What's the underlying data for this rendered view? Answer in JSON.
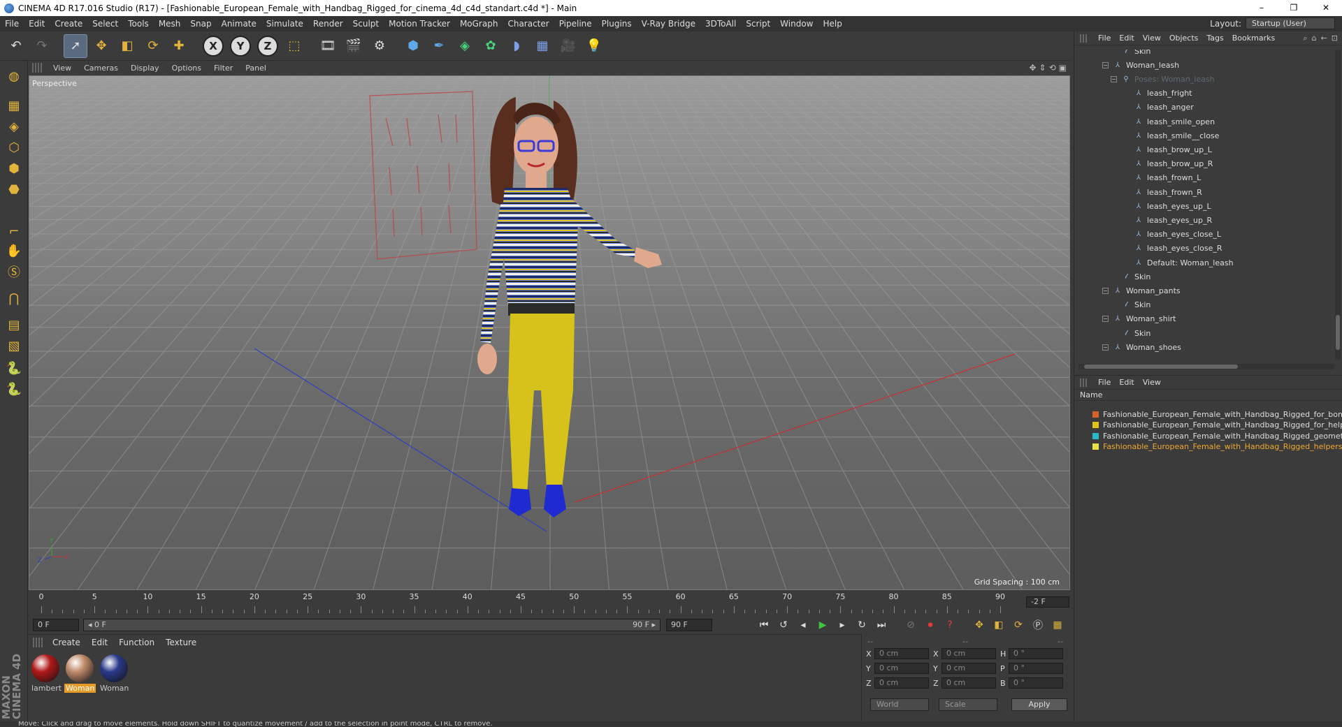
{
  "window": {
    "title": "CINEMA 4D R17.016 Studio (R17) - [Fashionable_European_Female_with_Handbag_Rigged_for_cinema_4d_c4d_standart.c4d *] - Main",
    "controls": [
      "–",
      "❐",
      "✕"
    ]
  },
  "menubar": {
    "items": [
      "File",
      "Edit",
      "Create",
      "Select",
      "Tools",
      "Mesh",
      "Snap",
      "Animate",
      "Simulate",
      "Render",
      "Sculpt",
      "Motion Tracker",
      "MoGraph",
      "Character",
      "Pipeline",
      "Plugins",
      "V-Ray Bridge",
      "3DToAll",
      "Script",
      "Window",
      "Help"
    ],
    "layout_label": "Layout:",
    "layout_value": "Startup (User)"
  },
  "toolbar": {
    "icons": [
      "undo-icon",
      "redo-icon",
      "live-select-icon",
      "move-icon",
      "scale-icon",
      "rotate-icon",
      "add-object-icon",
      "x-axis-icon",
      "y-axis-icon",
      "z-axis-icon",
      "coordinate-system-icon",
      "render-view-icon",
      "render-picture-viewer-icon",
      "render-settings-icon",
      "cube-icon",
      "pen-spline-icon",
      "subdivision-icon",
      "cloner-icon",
      "deformer-icon",
      "floor-icon",
      "camera-icon",
      "light-icon"
    ],
    "axis_labels": [
      "X",
      "Y",
      "Z"
    ]
  },
  "lefttools": [
    "model-mode-icon",
    "texture-mode-icon",
    "workplane-icon",
    "points-mode-icon",
    "edges-mode-icon",
    "polygons-mode-icon",
    "axis-mode-icon",
    "tweak-icon",
    "snap-icon",
    "magnet-icon",
    "grid-lock-icon",
    "grid-workplane-icon",
    "python-icon",
    "python-2-icon"
  ],
  "maxon_logo": "MAXON CINEMA 4D",
  "viewport": {
    "menu": [
      "View",
      "Cameras",
      "Display",
      "Options",
      "Filter",
      "Panel"
    ],
    "label": "Perspective",
    "grid_spacing": "Grid Spacing : 100 cm"
  },
  "timeline": {
    "ticks": [
      "0",
      "5",
      "10",
      "15",
      "20",
      "25",
      "30",
      "35",
      "40",
      "45",
      "50",
      "55",
      "60",
      "65",
      "70",
      "75",
      "80",
      "85",
      "90"
    ],
    "current_frame": "-2 F"
  },
  "transport": {
    "start_field": "0 F",
    "range_start": "◂ 0 F",
    "range_end": "90 F ▸",
    "end_field": "90 F"
  },
  "materials": {
    "menu": [
      "Create",
      "Edit",
      "Function",
      "Texture"
    ],
    "items": [
      {
        "name": "lambert",
        "color": "#b01818",
        "selected": false
      },
      {
        "name": "Woman",
        "color": "#c08a6a",
        "selected": true
      },
      {
        "name": "Woman",
        "color": "#2a3a8a",
        "selected": false
      }
    ]
  },
  "coordinates": {
    "headers": [
      "--",
      "--",
      "--"
    ],
    "rows": [
      {
        "a": "X",
        "a_val": "0 cm",
        "b": "X",
        "b_val": "0 cm",
        "c": "H",
        "c_val": "0 °"
      },
      {
        "a": "Y",
        "a_val": "0 cm",
        "b": "Y",
        "b_val": "0 cm",
        "c": "P",
        "c_val": "0 °"
      },
      {
        "a": "Z",
        "a_val": "0 cm",
        "b": "Z",
        "b_val": "0 cm",
        "c": "B",
        "c_val": "0 °"
      }
    ],
    "mode": "World",
    "scale_mode": "Scale",
    "apply": "Apply"
  },
  "object_manager": {
    "menu": [
      "File",
      "Edit",
      "View",
      "Objects",
      "Tags",
      "Bookmarks"
    ],
    "tree": [
      {
        "label": "Skin",
        "icon": "skin-icon",
        "indent": 1,
        "dim": false
      },
      {
        "label": "Woman_leash",
        "icon": "joint-icon",
        "indent": 0,
        "dim": false,
        "expander": "−"
      },
      {
        "label": "Poses: Woman_leash",
        "icon": "pose-morph-icon",
        "indent": 1,
        "dim": true,
        "expander": "−"
      },
      {
        "label": "leash_fright",
        "icon": "pose-icon",
        "indent": 2,
        "dim": false
      },
      {
        "label": "leash_anger",
        "icon": "pose-icon",
        "indent": 2,
        "dim": false
      },
      {
        "label": "leash_smile_open",
        "icon": "pose-icon",
        "indent": 2,
        "dim": false
      },
      {
        "label": "leash_smile__close",
        "icon": "pose-icon",
        "indent": 2,
        "dim": false
      },
      {
        "label": "leash_brow_up_L",
        "icon": "pose-icon",
        "indent": 2,
        "dim": false
      },
      {
        "label": "leash_brow_up_R",
        "icon": "pose-icon",
        "indent": 2,
        "dim": false
      },
      {
        "label": "leash_frown_L",
        "icon": "pose-icon",
        "indent": 2,
        "dim": false
      },
      {
        "label": "leash_frown_R",
        "icon": "pose-icon",
        "indent": 2,
        "dim": false
      },
      {
        "label": "leash_eyes_up_L",
        "icon": "pose-icon",
        "indent": 2,
        "dim": false
      },
      {
        "label": "leash_eyes_up_R",
        "icon": "pose-icon",
        "indent": 2,
        "dim": false
      },
      {
        "label": "leash_eyes_close_L",
        "icon": "pose-icon",
        "indent": 2,
        "dim": false
      },
      {
        "label": "leash_eyes_close_R",
        "icon": "pose-icon",
        "indent": 2,
        "dim": false
      },
      {
        "label": "Default: Woman_leash",
        "icon": "pose-icon",
        "indent": 2,
        "dim": false
      },
      {
        "label": "Skin",
        "icon": "skin-icon",
        "indent": 1,
        "dim": false
      },
      {
        "label": "Woman_pants",
        "icon": "joint-icon",
        "indent": 0,
        "dim": false,
        "expander": "−"
      },
      {
        "label": "Skin",
        "icon": "skin-icon",
        "indent": 1,
        "dim": false
      },
      {
        "label": "Woman_shirt",
        "icon": "joint-icon",
        "indent": 0,
        "dim": false,
        "expander": "−"
      },
      {
        "label": "Skin",
        "icon": "skin-icon",
        "indent": 1,
        "dim": false
      },
      {
        "label": "Woman_shoes",
        "icon": "joint-icon",
        "indent": 0,
        "dim": false,
        "expander": "−"
      }
    ]
  },
  "layer_manager": {
    "menu": [
      "File",
      "Edit",
      "View"
    ],
    "name_header": "Name",
    "layers": [
      {
        "name": "Fashionable_European_Female_with_Handbag_Rigged_for_bone",
        "color": "#d4622a",
        "highlight": false
      },
      {
        "name": "Fashionable_European_Female_with_Handbag_Rigged_for_help",
        "color": "#e2c21a",
        "highlight": false
      },
      {
        "name": "Fashionable_European_Female_with_Handbag_Rigged_geometr",
        "color": "#2ab8c8",
        "highlight": false
      },
      {
        "name": "Fashionable_European_Female_with_Handbag_Rigged_helpers",
        "color": "#e8e04a",
        "highlight": true
      }
    ]
  },
  "statusbar": "Move: Click and drag to move elements. Hold down SHIFT to quantize movement / add to the selection in point mode, CTRL to remove."
}
